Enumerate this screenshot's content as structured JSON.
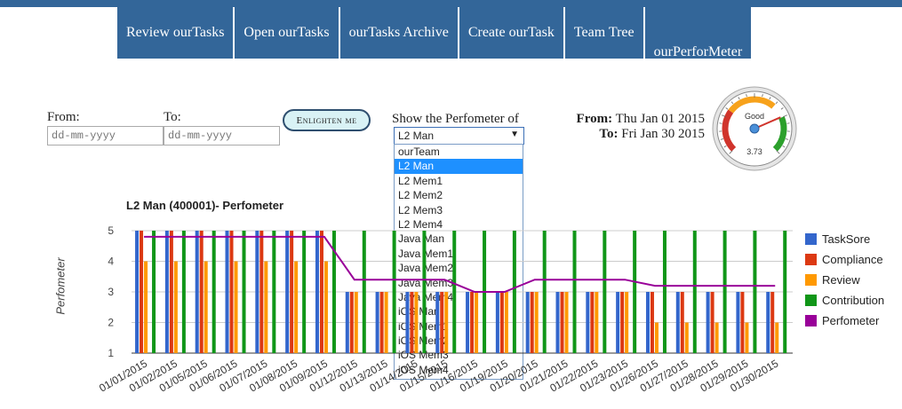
{
  "nav": {
    "items": [
      {
        "label": "Review ourTasks"
      },
      {
        "label": "Open ourTasks"
      },
      {
        "label": "ourTasks Archive"
      },
      {
        "label": "Create ourTask"
      },
      {
        "label": "Team Tree"
      },
      {
        "label": "ourPerforMeter"
      }
    ],
    "active_index": 5,
    "color": "#336699"
  },
  "filters": {
    "from_label": "From:",
    "to_label": "To:",
    "from_placeholder": "dd-mm-yyyy",
    "to_placeholder": "dd-mm-yyyy",
    "enlighten_label": "Enlighten me",
    "show_label": "Show the Perfometer of",
    "selected": "L2 Man",
    "options": [
      "ourTeam",
      "L2 Man",
      "L2 Mem1",
      "L2 Mem2",
      "L2 Mem3",
      "L2 Mem4",
      "Java Man",
      "Java Mem1",
      "Java Mem2",
      "Java Mem3",
      "Java Mem4",
      "iOS Man",
      "iOS Mem1",
      "iOS Mem2",
      "iOS Mem3",
      "iOS Mem4"
    ]
  },
  "range": {
    "from_key": "From:",
    "from_value": "Thu Jan 01 2015",
    "to_key": "To:",
    "to_value": "Fri Jan 30 2015"
  },
  "gauge": {
    "label": "Good",
    "value": 3.73,
    "min": 0,
    "max": 5
  },
  "chart_data": {
    "type": "bar",
    "title": "L2 Man (400001)- Perfometer",
    "ylabel": "Perfometer",
    "xlabel": "",
    "ylim": [
      1,
      5
    ],
    "yticks": [
      1,
      2,
      3,
      4,
      5
    ],
    "grid": true,
    "legend_position": "right",
    "categories": [
      "01/01/2015",
      "01/02/2015",
      "01/05/2015",
      "01/06/2015",
      "01/07/2015",
      "01/08/2015",
      "01/09/2015",
      "01/12/2015",
      "01/13/2015",
      "01/14/2015",
      "01/15/2015",
      "01/16/2015",
      "01/19/2015",
      "01/20/2015",
      "01/21/2015",
      "01/22/2015",
      "01/23/2015",
      "01/26/2015",
      "01/27/2015",
      "01/28/2015",
      "01/29/2015",
      "01/30/2015"
    ],
    "series": [
      {
        "name": "TaskSore",
        "kind": "bar",
        "color": "#3366cc",
        "values": [
          5,
          5,
          5,
          5,
          5,
          5,
          5,
          3,
          3,
          3,
          3,
          3,
          3,
          3,
          3,
          3,
          3,
          3,
          3,
          3,
          3,
          3
        ]
      },
      {
        "name": "Compliance",
        "kind": "bar",
        "color": "#dc3912",
        "values": [
          5,
          5,
          5,
          5,
          5,
          5,
          5,
          3,
          3,
          3,
          3,
          3,
          3,
          3,
          3,
          3,
          3,
          3,
          3,
          3,
          3,
          3
        ]
      },
      {
        "name": "Review",
        "kind": "bar",
        "color": "#ff9900",
        "values": [
          4,
          4,
          4,
          4,
          4,
          4,
          4,
          3,
          3,
          3,
          3,
          3,
          3,
          3,
          3,
          3,
          3,
          2,
          2,
          2,
          2,
          2
        ]
      },
      {
        "name": "Contribution",
        "kind": "bar",
        "color": "#109618",
        "values": [
          5,
          5,
          5,
          5,
          5,
          5,
          5,
          5,
          5,
          5,
          5,
          5,
          5,
          5,
          5,
          5,
          5,
          5,
          5,
          5,
          5,
          5
        ]
      },
      {
        "name": "Perfometer",
        "kind": "line",
        "color": "#990099",
        "values": [
          4.8,
          4.8,
          4.8,
          4.8,
          4.8,
          4.8,
          4.8,
          3.4,
          3.4,
          3.4,
          3.4,
          3.0,
          3.0,
          3.4,
          3.4,
          3.4,
          3.4,
          3.2,
          3.2,
          3.2,
          3.2,
          3.2
        ]
      }
    ]
  }
}
